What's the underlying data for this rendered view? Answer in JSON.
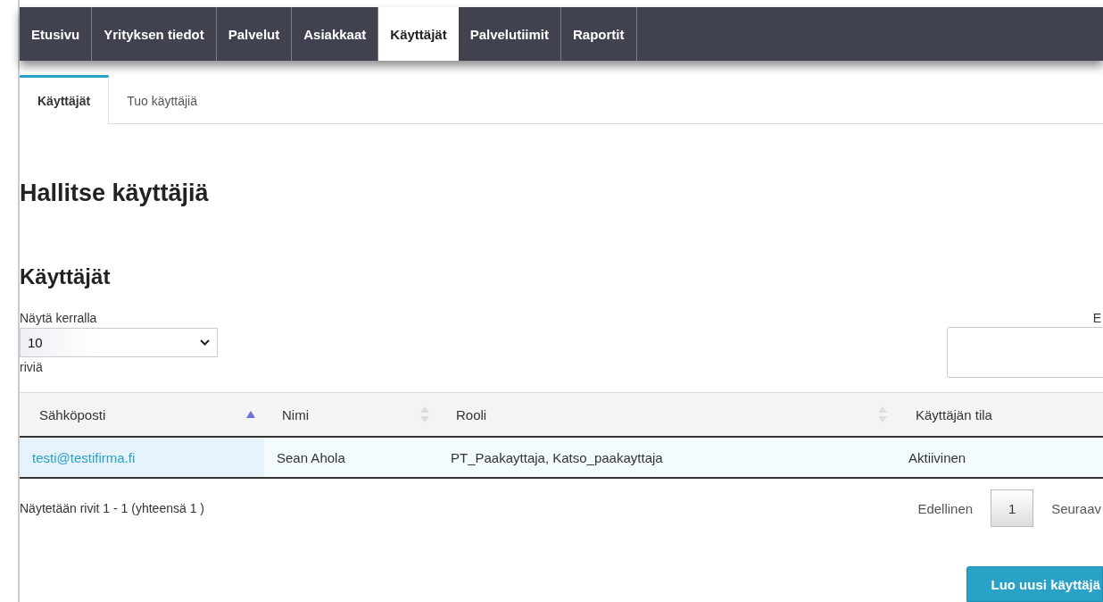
{
  "nav": [
    {
      "label": "Etusivu",
      "selected": false
    },
    {
      "label": "Yrityksen tiedot",
      "selected": false
    },
    {
      "label": "Palvelut",
      "selected": false
    },
    {
      "label": "Asiakkaat",
      "selected": false
    },
    {
      "label": "Käyttäjät",
      "selected": true
    },
    {
      "label": "Palvelutiimit",
      "selected": false
    },
    {
      "label": "Raportit",
      "selected": false
    }
  ],
  "subtabs": [
    {
      "label": "Käyttäjät",
      "selected": true
    },
    {
      "label": "Tuo käyttäjiä",
      "selected": false
    }
  ],
  "page_title": "Hallitse käyttäjiä",
  "section_title": "Käyttäjät",
  "length": {
    "label": "Näytä kerralla",
    "value": "10",
    "suffix": "riviä"
  },
  "search": {
    "label": "E"
  },
  "table": {
    "columns": [
      {
        "label": "Sähköposti",
        "sorted": true
      },
      {
        "label": "Nimi",
        "sorted": false
      },
      {
        "label": "Rooli",
        "sorted": false
      },
      {
        "label": "Käyttäjän tila"
      }
    ],
    "rows": [
      {
        "cells": [
          "testi@testifirma.fi",
          "Sean Ahola",
          "PT_Paakayttaja, Katso_paakayttaja",
          "Aktiivinen"
        ]
      }
    ]
  },
  "info": "Näytetään rivit 1 - 1 (yhteensä 1 )",
  "pagination": {
    "previous": "Edellinen",
    "pages": [
      {
        "label": "1",
        "selected": true
      }
    ],
    "next": "Seuraav"
  },
  "create_button": "Luo uusi käyttäjä"
}
